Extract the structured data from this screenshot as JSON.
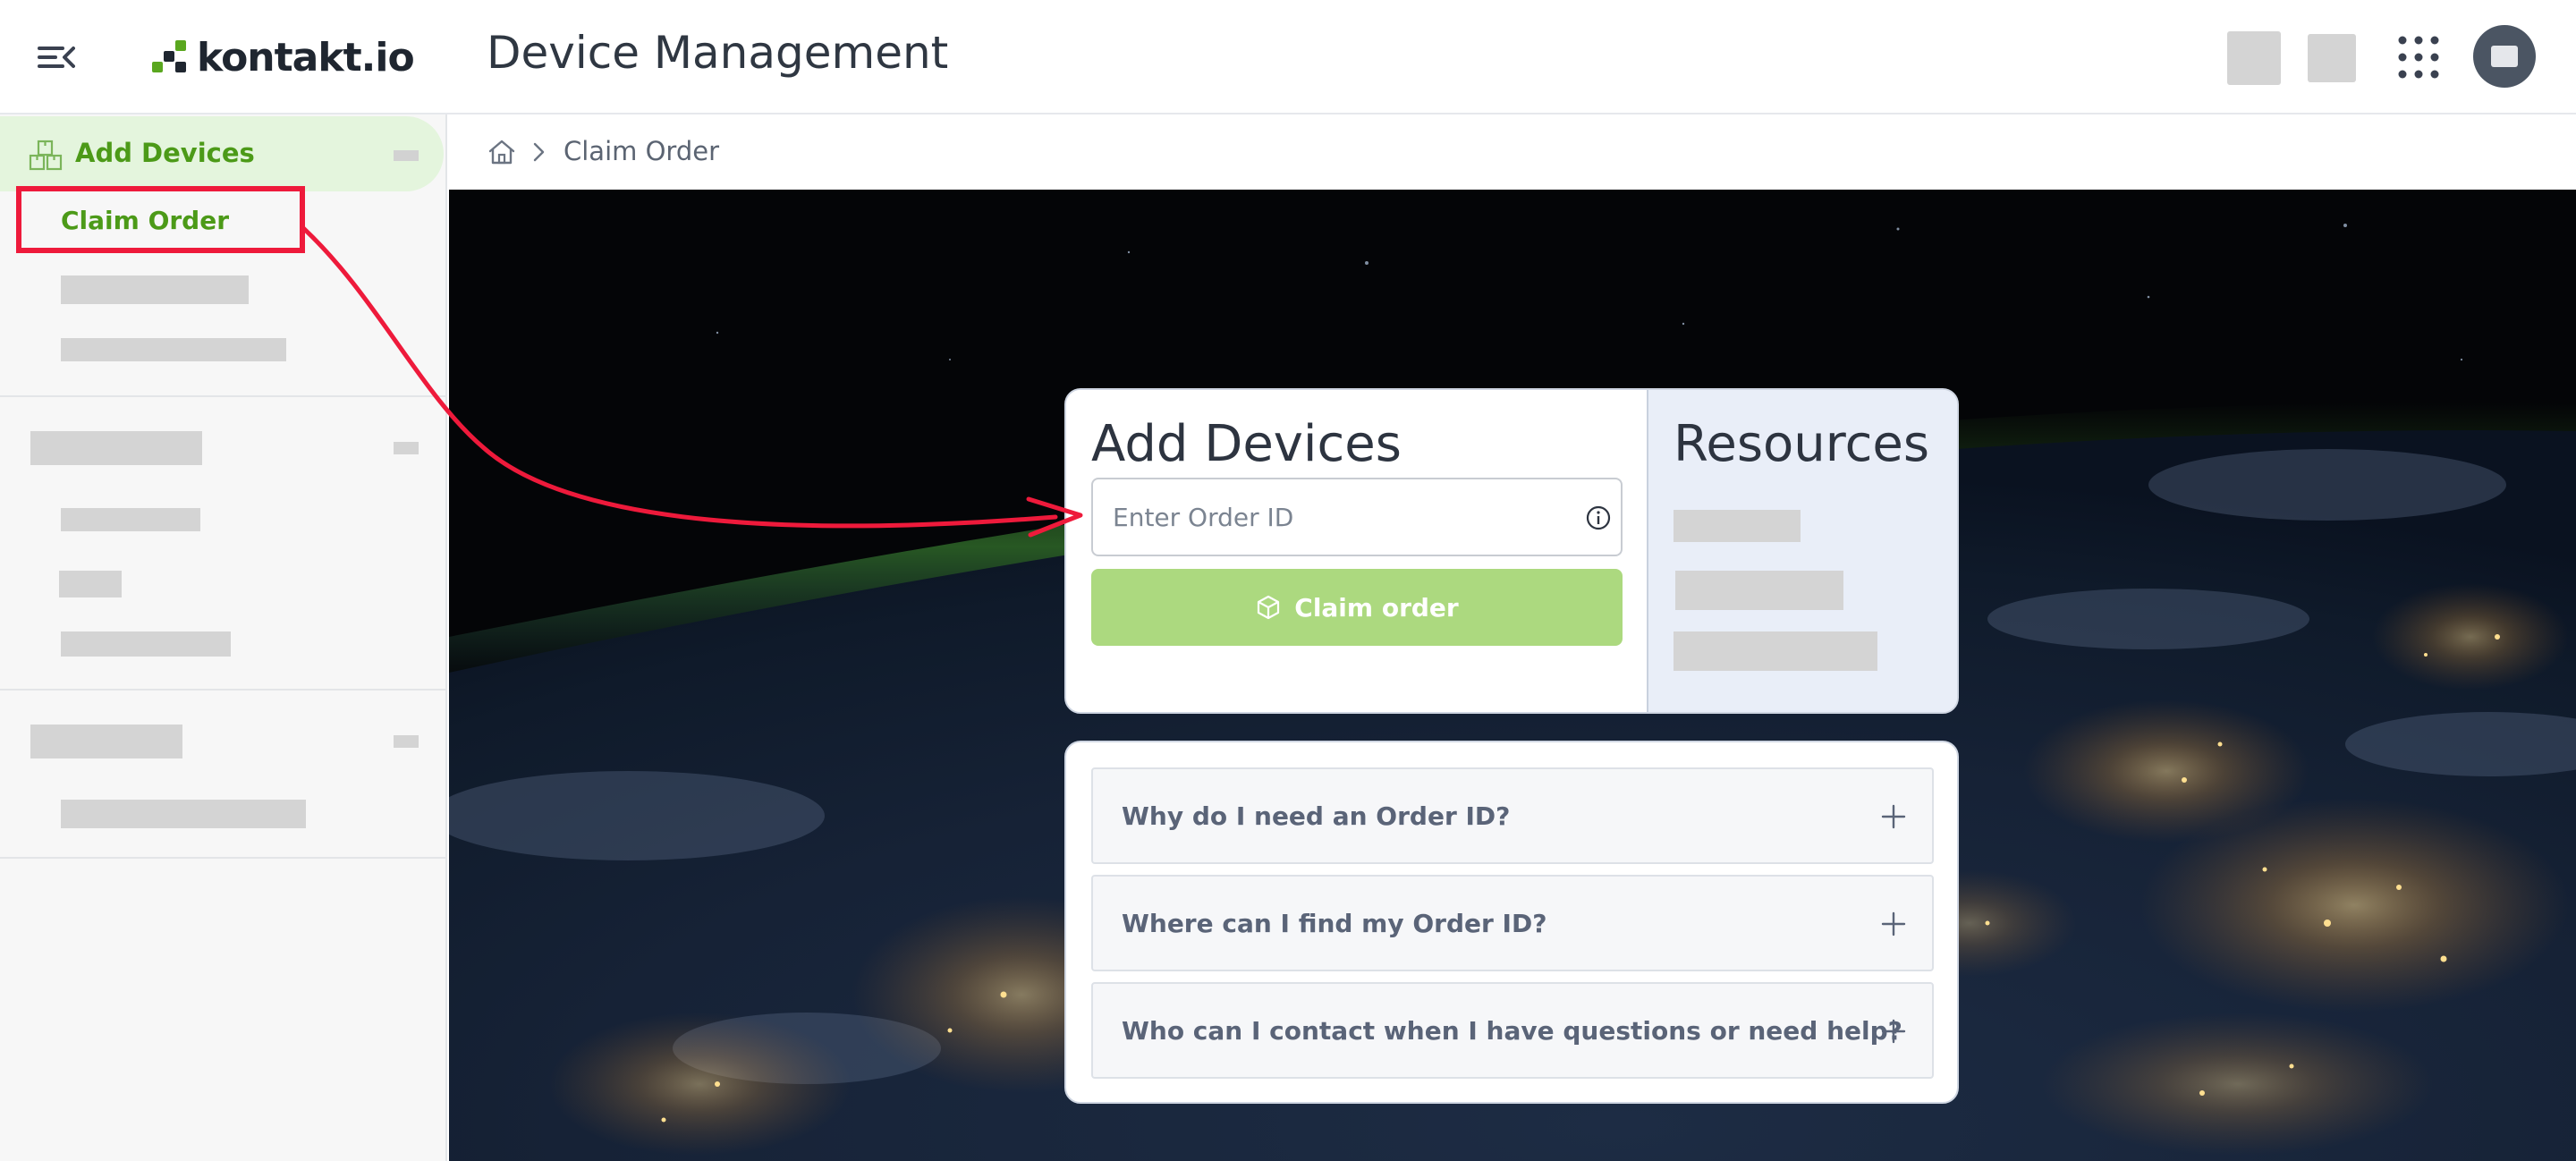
{
  "header": {
    "logo_text": "kontakt.io",
    "app_title": "Device Management"
  },
  "sidebar": {
    "section_label": "Add Devices",
    "active_item_label": "Claim Order"
  },
  "breadcrumb": {
    "current": "Claim Order"
  },
  "add_devices": {
    "title": "Add Devices",
    "order_input_placeholder": "Enter Order ID",
    "order_input_value": "",
    "claim_button_label": "Claim order"
  },
  "resources": {
    "title": "Resources"
  },
  "faq": {
    "items": [
      {
        "question": "Why do I need an Order ID?"
      },
      {
        "question": "Where can I find my Order ID?"
      },
      {
        "question": "Who can I contact when I have questions or need help?"
      }
    ]
  },
  "colors": {
    "brand_green": "#4c9a18",
    "button_green_disabled": "#acd97f",
    "annotation_red": "#ee1a3b",
    "resources_panel": "#e9eef8"
  },
  "icons": {
    "menu": "menu-collapse-icon",
    "section": "boxes-icon",
    "home": "home-icon",
    "info": "info-icon",
    "claim": "cube-icon",
    "expand": "plus-icon",
    "apps": "apps-grid-icon"
  }
}
